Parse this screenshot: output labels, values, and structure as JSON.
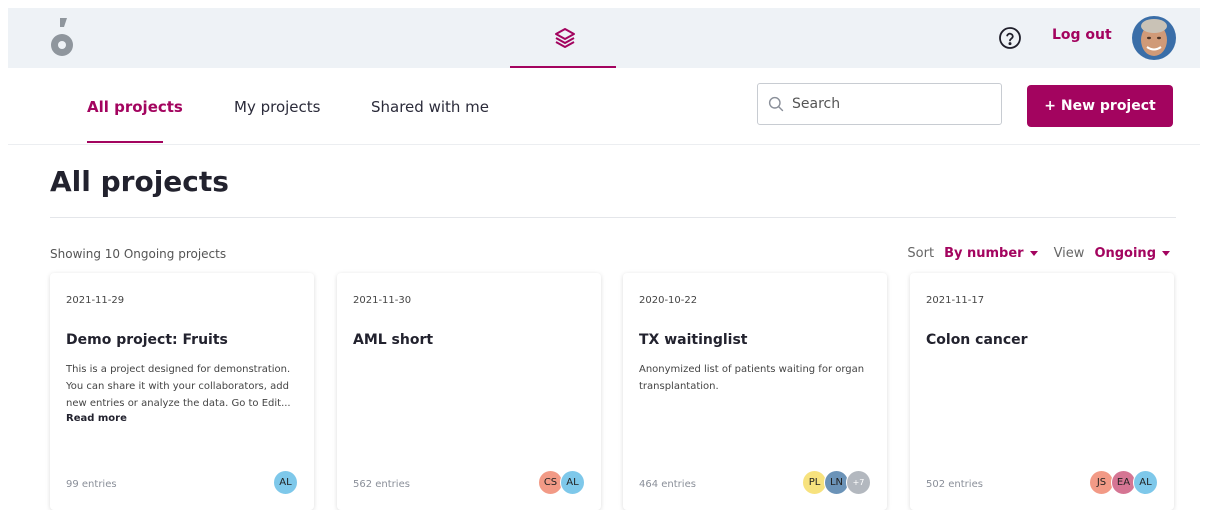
{
  "header": {
    "logout_label": "Log out"
  },
  "nav": {
    "tabs": [
      {
        "label": "All projects",
        "active": true
      },
      {
        "label": "My projects",
        "active": false
      },
      {
        "label": "Shared with me",
        "active": false
      }
    ],
    "search_placeholder": "Search",
    "new_project_label": "+ New project"
  },
  "main": {
    "title": "All projects",
    "showing_text": "Showing 10 Ongoing projects",
    "sort_label": "Sort",
    "sort_value": "By number",
    "view_label": "View",
    "view_value": "Ongoing"
  },
  "colors": {
    "accent": "#a3045f",
    "header_bg": "#eef2f6"
  },
  "projects": [
    {
      "date": "2021-11-29",
      "title": "Demo project: Fruits",
      "description": "This is a project designed for demonstration. You can share it with your collaborators, add new entries or analyze the data. Go to Edit...",
      "read_more": "Read more",
      "entries": "99 entries",
      "members": [
        {
          "initials": "AL",
          "color": "#7ec8ea"
        }
      ]
    },
    {
      "date": "2021-11-30",
      "title": "AML short",
      "description": "",
      "read_more": "",
      "entries": "562 entries",
      "members": [
        {
          "initials": "CS",
          "color": "#f29a86"
        },
        {
          "initials": "AL",
          "color": "#7ec8ea"
        }
      ]
    },
    {
      "date": "2020-10-22",
      "title": "TX waitinglist",
      "description": "Anonymized list of patients waiting for organ transplantation.",
      "read_more": "",
      "entries": "464 entries",
      "members": [
        {
          "initials": "PL",
          "color": "#f7e27e"
        },
        {
          "initials": "LN",
          "color": "#6b93b8"
        },
        {
          "initials": "+7",
          "color": "#b3b8bf"
        }
      ]
    },
    {
      "date": "2021-11-17",
      "title": "Colon cancer",
      "description": "",
      "read_more": "",
      "entries": "502 entries",
      "members": [
        {
          "initials": "JS",
          "color": "#f29a86"
        },
        {
          "initials": "EA",
          "color": "#d57593"
        },
        {
          "initials": "AL",
          "color": "#7ec8ea"
        }
      ]
    }
  ]
}
